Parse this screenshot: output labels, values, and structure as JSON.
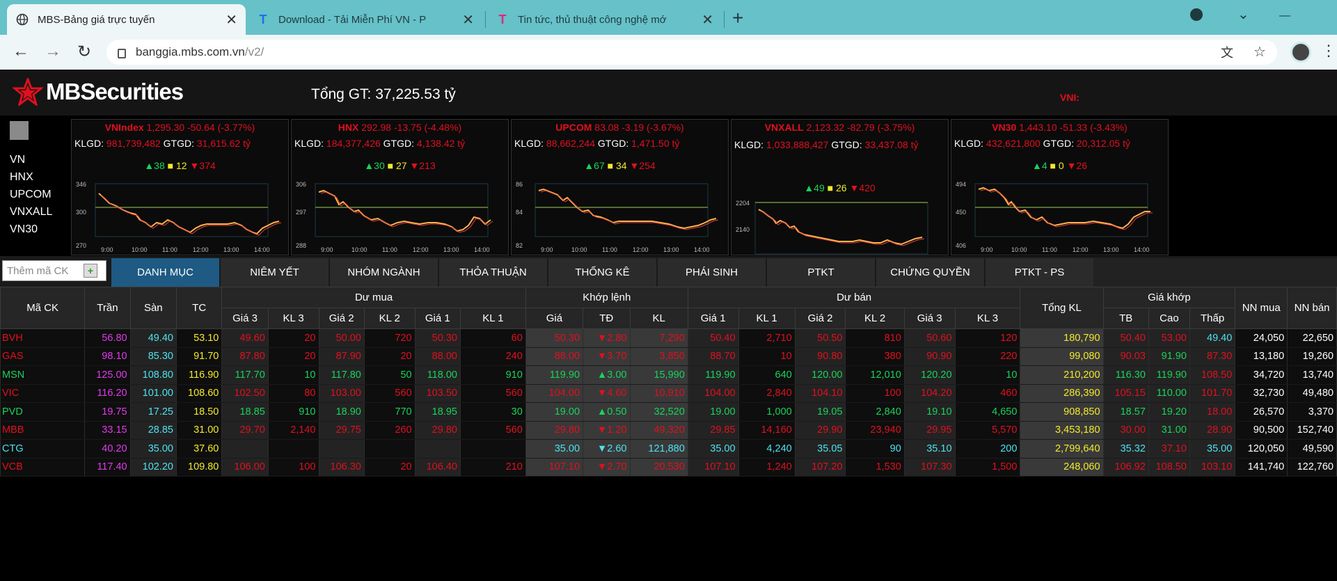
{
  "browser": {
    "tabs": [
      {
        "title": "MBS-Bảng giá trực tuyến",
        "active": true,
        "icon": "globe-icon"
      },
      {
        "title": "Download - Tải Miễn Phí VN - P",
        "active": false,
        "icon": "t-logo-blue-icon"
      },
      {
        "title": "Tin tức, thủ thuật công nghệ mớ",
        "active": false,
        "icon": "t-logo-pink-icon"
      }
    ],
    "url_host": "banggia.mbs.com.vn",
    "url_path": "/v2/"
  },
  "header": {
    "logo_text": "MBSecurities",
    "total_gt": "Tổng GT: 37,225.53 tỷ",
    "vni_label": "VNI:"
  },
  "index_list": [
    "VN",
    "HNX",
    "UPCOM",
    "VNXALL",
    "VN30"
  ],
  "indices": [
    {
      "name": "VNIndex",
      "value": "1,295.30",
      "change": "-50.64 (-3.77%)",
      "klgd": "981,739,482",
      "gtgd": "31,615.62 tỷ",
      "up": "38",
      "ref": "12",
      "down": "374",
      "y_top": "346",
      "y_mid": "300",
      "y_bot": "270",
      "x_ticks": [
        "9:00",
        "10:00",
        "11:00",
        "12:00",
        "13:00",
        "14:00"
      ]
    },
    {
      "name": "HNX",
      "value": "292.98",
      "change": "-13.75 (-4.48%)",
      "klgd": "184,377,426",
      "gtgd": "4,138.42 tỷ",
      "up": "30",
      "ref": "27",
      "down": "213",
      "y_top": "306",
      "y_mid": "297",
      "y_bot": "288",
      "x_ticks": [
        "9:00",
        "10:00",
        "11:00",
        "12:00",
        "13:00",
        "14:00"
      ]
    },
    {
      "name": "UPCOM",
      "value": "83.08",
      "change": "-3.19 (-3.67%)",
      "klgd": "88,662,244",
      "gtgd": "1,471.50 tỷ",
      "up": "67",
      "ref": "34",
      "down": "254",
      "y_top": "86",
      "y_mid": "84",
      "y_bot": "82",
      "x_ticks": [
        "9:00",
        "10:00",
        "11:00",
        "12:00",
        "13:00",
        "14:00"
      ]
    },
    {
      "name": "VNXALL",
      "value": "2,123.32",
      "change": "-82.79 (-3.75%)",
      "klgd": "1,033,888,427",
      "gtgd": "33,437.08 tỷ",
      "up": "49",
      "ref": "26",
      "down": "420",
      "y_top": "2204",
      "y_mid": "2140",
      "y_bot": "",
      "x_ticks": []
    },
    {
      "name": "VN30",
      "value": "1,443.10",
      "change": "-51.33 (-3.43%)",
      "klgd": "432,621,800",
      "gtgd": "20,312.05 tỷ",
      "up": "4",
      "ref": "0",
      "down": "26",
      "y_top": "494",
      "y_mid": "450",
      "y_bot": "406",
      "x_ticks": [
        "9:00",
        "10:00",
        "11:00",
        "12:00",
        "13:00",
        "14:00"
      ]
    }
  ],
  "search": {
    "placeholder": "Thêm mã CK"
  },
  "nav_tabs": [
    "DANH MỤC",
    "NIÊM YẾT",
    "NHÓM NGÀNH",
    "THỎA THUẬN",
    "THỐNG KÊ",
    "PHÁI SINH",
    "PTKT",
    "CHỨNG QUYỀN",
    "PTKT - PS"
  ],
  "table": {
    "group_headers": {
      "ma_ck": "Mã CK",
      "tran": "Trần",
      "san": "Sàn",
      "tc": "TC",
      "du_mua": "Dư mua",
      "khop_lenh": "Khớp lệnh",
      "du_ban": "Dư bán",
      "tong_kl": "Tổng KL",
      "gia_khop": "Giá khớp",
      "nn_mua": "NN mua",
      "nn_ban": "NN bán"
    },
    "sub_headers": {
      "du_mua": [
        "Giá 3",
        "KL 3",
        "Giá 2",
        "KL 2",
        "Giá 1",
        "KL 1"
      ],
      "khop_lenh": [
        "Giá",
        "TĐ",
        "KL"
      ],
      "du_ban": [
        "Giá 1",
        "KL 1",
        "Giá 2",
        "KL 2",
        "Giá 3",
        "KL 3"
      ],
      "gia_khop": [
        "TB",
        "Cao",
        "Thấp"
      ]
    },
    "rows": [
      {
        "ck": "BVH",
        "tran": "56.80",
        "san": "49.40",
        "tc": "53.10",
        "mua": [
          "49.60",
          "20",
          "50.00",
          "720",
          "50.30",
          "60"
        ],
        "khop": [
          "50.30",
          "▼2.80",
          "7,290"
        ],
        "ban": [
          "50.40",
          "2,710",
          "50.50",
          "810",
          "50.60",
          "120"
        ],
        "tong": "180,790",
        "tb": "50.40",
        "cao": "53.00",
        "thap": "49.40",
        "nnm": "24,050",
        "nnb": "22,650",
        "color": "r",
        "cao_c": "r",
        "thap_c": "c"
      },
      {
        "ck": "GAS",
        "tran": "98.10",
        "san": "85.30",
        "tc": "91.70",
        "mua": [
          "87.80",
          "20",
          "87.90",
          "20",
          "88.00",
          "240"
        ],
        "khop": [
          "88.00",
          "▼3.70",
          "3,850"
        ],
        "ban": [
          "88.70",
          "10",
          "90.80",
          "380",
          "90.90",
          "220"
        ],
        "tong": "99,080",
        "tb": "90.03",
        "cao": "91.90",
        "thap": "87.30",
        "nnm": "13,180",
        "nnb": "19,260",
        "color": "r",
        "cao_c": "g",
        "thap_c": "r"
      },
      {
        "ck": "MSN",
        "tran": "125.00",
        "san": "108.80",
        "tc": "116.90",
        "mua": [
          "117.70",
          "10",
          "117.80",
          "50",
          "118.00",
          "910"
        ],
        "khop": [
          "119.90",
          "▲3.00",
          "15,990"
        ],
        "ban": [
          "119.90",
          "640",
          "120.00",
          "12,010",
          "120.20",
          "10"
        ],
        "tong": "210,200",
        "tb": "116.30",
        "cao": "119.90",
        "thap": "108.50",
        "nnm": "34,720",
        "nnb": "13,740",
        "color": "g",
        "cao_c": "g",
        "thap_c": "r"
      },
      {
        "ck": "VIC",
        "tran": "116.20",
        "san": "101.00",
        "tc": "108.60",
        "mua": [
          "102.50",
          "80",
          "103.00",
          "560",
          "103.50",
          "560"
        ],
        "khop": [
          "104.00",
          "▼4.60",
          "10,910"
        ],
        "ban": [
          "104.00",
          "2,840",
          "104.10",
          "100",
          "104.20",
          "460"
        ],
        "tong": "286,390",
        "tb": "105.15",
        "cao": "110.00",
        "thap": "101.70",
        "nnm": "32,730",
        "nnb": "49,480",
        "color": "r",
        "cao_c": "g",
        "thap_c": "r"
      },
      {
        "ck": "PVD",
        "tran": "19.75",
        "san": "17.25",
        "tc": "18.50",
        "mua": [
          "18.85",
          "910",
          "18.90",
          "770",
          "18.95",
          "30"
        ],
        "khop": [
          "19.00",
          "▲0.50",
          "32,520"
        ],
        "ban": [
          "19.00",
          "1,000",
          "19.05",
          "2,840",
          "19.10",
          "4,650"
        ],
        "tong": "908,850",
        "tb": "18.57",
        "cao": "19.20",
        "thap": "18.00",
        "nnm": "26,570",
        "nnb": "3,370",
        "color": "g",
        "cao_c": "g",
        "thap_c": "r"
      },
      {
        "ck": "MBB",
        "tran": "33.15",
        "san": "28.85",
        "tc": "31.00",
        "mua": [
          "29.70",
          "2,140",
          "29.75",
          "260",
          "29.80",
          "560"
        ],
        "khop": [
          "29.80",
          "▼1.20",
          "49,320"
        ],
        "ban": [
          "29.85",
          "14,160",
          "29.90",
          "23,940",
          "29.95",
          "5,570"
        ],
        "tong": "3,453,180",
        "tb": "30.00",
        "cao": "31.00",
        "thap": "28.90",
        "nnm": "90,500",
        "nnb": "152,740",
        "color": "r",
        "cao_c": "g",
        "thap_c": "r"
      },
      {
        "ck": "CTG",
        "tran": "40.20",
        "san": "35.00",
        "tc": "37.60",
        "mua": [
          "",
          "",
          "",
          "",
          "",
          ""
        ],
        "khop": [
          "35.00",
          "▼2.60",
          "121,880"
        ],
        "ban": [
          "35.00",
          "4,240",
          "35.05",
          "90",
          "35.10",
          "200"
        ],
        "tong": "2,799,640",
        "tb": "35.32",
        "cao": "37.10",
        "thap": "35.00",
        "nnm": "120,050",
        "nnb": "49,590",
        "color": "c",
        "cao_c": "r",
        "thap_c": "c"
      },
      {
        "ck": "VCB",
        "tran": "117.40",
        "san": "102.20",
        "tc": "109.80",
        "mua": [
          "106.00",
          "100",
          "106.30",
          "20",
          "106.40",
          "210"
        ],
        "khop": [
          "107.10",
          "▼2.70",
          "20,530"
        ],
        "ban": [
          "107.10",
          "1,240",
          "107.20",
          "1,530",
          "107.30",
          "1,500"
        ],
        "tong": "248,060",
        "tb": "106.92",
        "cao": "108.50",
        "thap": "103.10",
        "nnm": "141,740",
        "nnb": "122,760",
        "color": "r",
        "cao_c": "r",
        "thap_c": "r"
      }
    ]
  },
  "colors": {
    "up": "#19d35b",
    "down": "#e0101e",
    "ref": "#f2ea2c",
    "ceiling": "#e03bea",
    "floor": "#4ce3f0",
    "active_tab": "#1e5a83"
  }
}
